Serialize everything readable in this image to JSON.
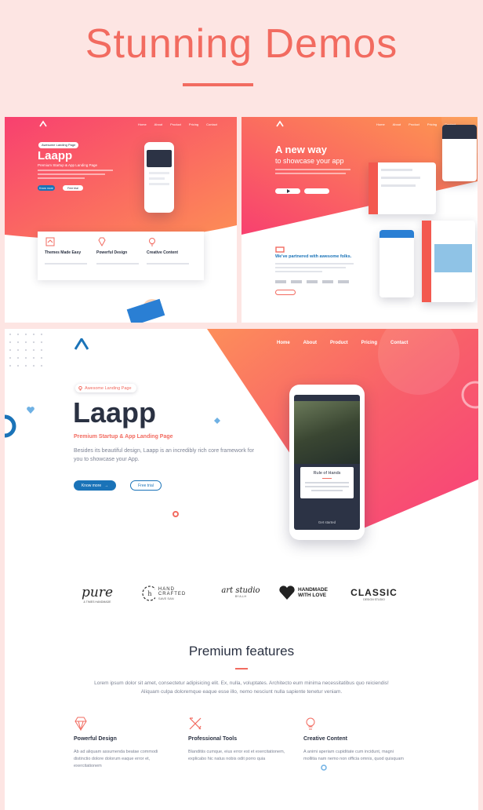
{
  "heading": {
    "title": "Stunning Demos"
  },
  "demo1": {
    "nav": [
      "Home",
      "About",
      "Product",
      "Pricing",
      "Contact"
    ],
    "badge": "Awesome Landing Page",
    "title": "Laapp",
    "subtitle": "Premium Startup & App Landing Page",
    "btn_primary": "Know more",
    "btn_secondary": "Free trial",
    "features": [
      {
        "title": "Themes Made Easy",
        "icon": "layers-icon"
      },
      {
        "title": "Powerful Design",
        "icon": "diamond-icon"
      },
      {
        "title": "Creative Content",
        "icon": "lightbulb-icon"
      }
    ]
  },
  "demo2": {
    "nav": [
      "Home",
      "About",
      "Product",
      "Pricing",
      "Contact"
    ],
    "title": "A new way",
    "subtitle": "to showcase your app",
    "partner_heading": "We've partnered with awesome folks."
  },
  "demo3": {
    "nav": [
      "Home",
      "About",
      "Product",
      "Pricing",
      "Contact"
    ],
    "badge": "Awesome Landing Page",
    "title": "Laapp",
    "subtitle": "Premium Startup & App Landing Page",
    "description": "Besides its beautiful design, Laapp is an incredibly rich core framework for you to showcase your App.",
    "btn_primary": "Know more",
    "btn_secondary": "Free trial",
    "phone_card": {
      "title": "Rule of Hands",
      "button": "Get started"
    },
    "brands": [
      {
        "top": "pure",
        "bottom": "& TIMES HANDMADE"
      },
      {
        "top": "HAND CRAFTED",
        "bottom": "SAVE SAN"
      },
      {
        "top": "art studio",
        "bottom": "BY A.L.H"
      },
      {
        "top": "HANDMADE",
        "bottom": "WITH LOVE"
      },
      {
        "top": "CLASSIC",
        "bottom": "DESIGN STUDIO"
      }
    ],
    "features_heading": "Premium features",
    "features_desc_1": "Lorem ipsum dolor sit amet, consectetur adipisicing elit. Ex, nulla, voluptates. Architecto eum minima necessitatibus quo reiciendis!",
    "features_desc_2": "Aliquam culpa doloremque eaque esse illo, nemo nesciunt nulla sapiente tenetur veniam.",
    "features": [
      {
        "title": "Powerful Design",
        "icon": "diamond-icon",
        "text": "Ab ad aliquam assumenda beatae commodi distinctio dolore dolorum eaque error et, exercitationem"
      },
      {
        "title": "Professional Tools",
        "icon": "tools-icon",
        "text": "Blanditiis cumque, eius error est et exercitationem, explicabo hic natus nobis odit porro quia"
      },
      {
        "title": "Creative Content",
        "icon": "lightbulb-icon",
        "text": "A animi aperiam cupiditate cum incidunt, magni mollitia nam nemo non officia omnis, quod quisquam"
      }
    ]
  },
  "colors": {
    "accent": "#f26b60",
    "brand_blue": "#1a73b8",
    "dark": "#2a3142"
  }
}
